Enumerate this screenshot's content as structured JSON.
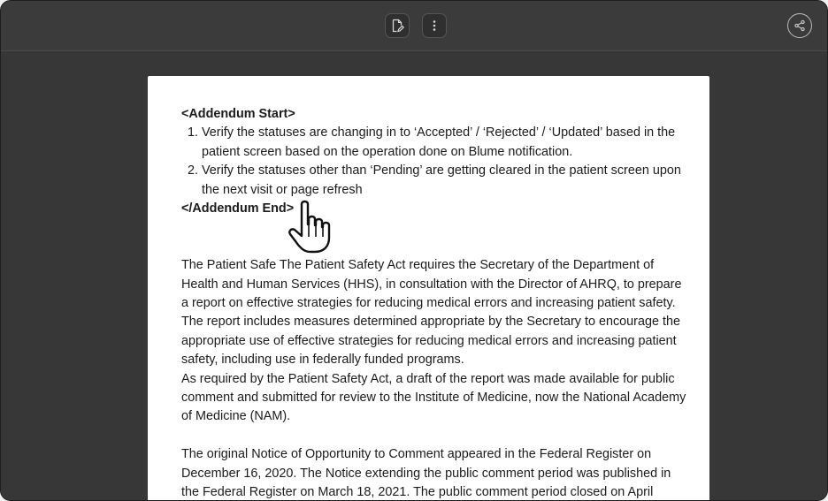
{
  "toolbar": {
    "edit_icon": "file-edit-icon",
    "more_icon": "more-vertical-icon",
    "share_icon": "share-icon"
  },
  "document": {
    "addendum_start": "<Addendum Start>",
    "list": [
      "Verify the statuses are changing in to ‘Accepted’ / ‘Rejected’ / ‘Updated’ based in the patient screen based on the operation done on Blume notification.",
      "Verify the statuses other than ‘Pending’ are getting cleared in the patient screen upon the next visit or page refresh"
    ],
    "addendum_end": "</Addendum End>",
    "paragraph1": "The Patient Safe The Patient Safety Act requires the Secretary of the Department of Health and Human Services (HHS), in consultation with the Director of AHRQ, to prepare a report on effective strategies for reducing medical errors and increasing patient safety. The report includes measures determined appropriate by the Secretary to encourage the appropriate use of effective strategies for reducing medical errors and increasing patient safety, including use in federally funded programs.",
    "paragraph2": "As required by the Patient Safety Act, a draft of the report was made available for public comment and submitted for review to the Institute of Medicine, now the National Academy of Medicine (NAM).",
    "paragraph3": "The original Notice of Opportunity to Comment appeared in the Federal Register on December 16, 2020. The Notice extending the public comment period was published in the Federal Register on March 18, 2021. The public comment period closed on April"
  },
  "cursor": {
    "icon": "hand-pointer-icon"
  },
  "colors": {
    "toolbar": "#3b3b3b",
    "canvas": "#373737",
    "page": "#ffffff",
    "text": "#1b1b1b"
  }
}
